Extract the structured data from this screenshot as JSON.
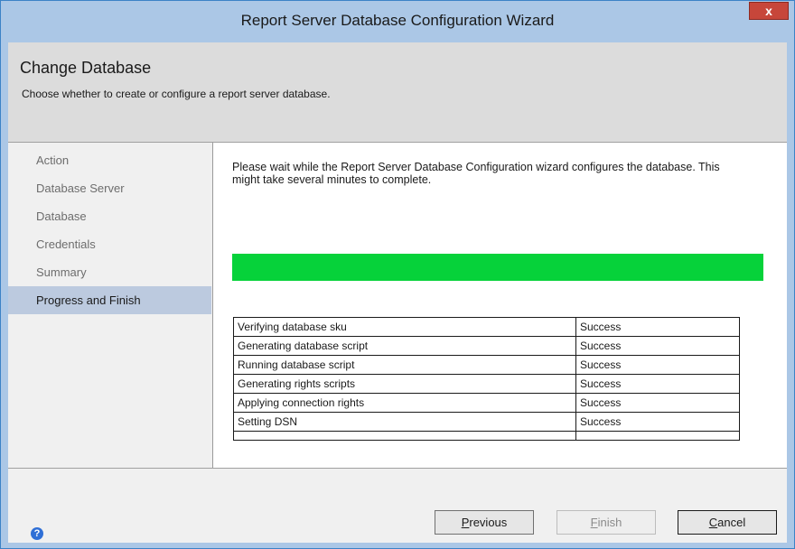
{
  "window": {
    "title": "Report Server Database Configuration Wizard",
    "close_glyph": "x"
  },
  "header": {
    "title": "Change Database",
    "subtitle": "Choose whether to create or configure a report server database."
  },
  "nav": {
    "items": [
      {
        "label": "Action",
        "active": false
      },
      {
        "label": "Database Server",
        "active": false
      },
      {
        "label": "Database",
        "active": false
      },
      {
        "label": "Credentials",
        "active": false
      },
      {
        "label": "Summary",
        "active": false
      },
      {
        "label": "Progress and Finish",
        "active": true
      }
    ]
  },
  "main": {
    "message": "Please wait while the Report Server Database Configuration wizard configures the database.  This might take several minutes to complete.",
    "progress_fraction": 1.0,
    "progress_color": "#06d23a",
    "results": [
      {
        "step": "Verifying database sku",
        "status": "Success"
      },
      {
        "step": "Generating database script",
        "status": "Success"
      },
      {
        "step": "Running database script",
        "status": "Success"
      },
      {
        "step": "Generating rights scripts",
        "status": "Success"
      },
      {
        "step": "Applying connection rights",
        "status": "Success"
      },
      {
        "step": "Setting DSN",
        "status": "Success"
      }
    ]
  },
  "footer": {
    "help_icon": "help-icon",
    "previous": {
      "mnemonic": "P",
      "rest": "revious",
      "enabled": true
    },
    "finish": {
      "mnemonic": "F",
      "rest": "inish",
      "enabled": false
    },
    "cancel": {
      "mnemonic": "C",
      "rest": "ancel",
      "enabled": true
    }
  }
}
